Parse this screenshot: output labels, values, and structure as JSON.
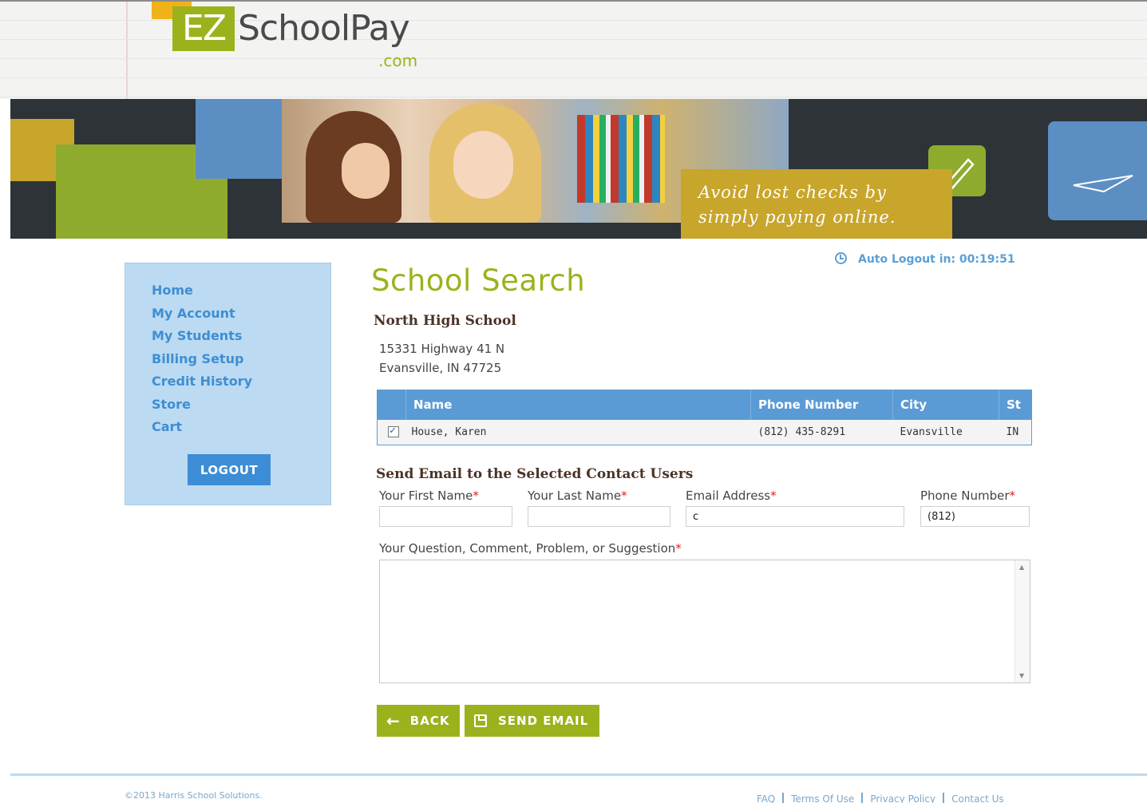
{
  "brand": {
    "logo_ez": "EZ",
    "logo_word": "SchoolPay",
    "logo_com": ".com"
  },
  "banner": {
    "tagline_line1": "Avoid lost checks by",
    "tagline_line2": "simply paying online."
  },
  "sidebar": {
    "items": [
      {
        "label": "Home"
      },
      {
        "label": "My Account"
      },
      {
        "label": "My Students"
      },
      {
        "label": "Billing Setup"
      },
      {
        "label": "Credit History"
      },
      {
        "label": "Store"
      },
      {
        "label": "Cart"
      }
    ],
    "logout_label": "LOGOUT"
  },
  "session": {
    "auto_logout": "Auto Logout in: 00:19:51"
  },
  "main": {
    "title": "School Search",
    "school_name": "North High School",
    "address_line1": "15331 Highway 41 N",
    "address_line2": "Evansville, IN  47725"
  },
  "contacts": {
    "columns": [
      "Name",
      "Phone Number",
      "City",
      "St"
    ],
    "rows": [
      {
        "checked": true,
        "name": "House, Karen",
        "phone": "(812) 435-8291",
        "city": "Evansville",
        "state": "IN"
      }
    ]
  },
  "form": {
    "section_title": "Send Email to the Selected Contact Users",
    "first_name_label": "Your First Name",
    "last_name_label": "Your Last Name",
    "email_label": "Email Address",
    "phone_label": "Phone Number",
    "required_mark": "*",
    "first_name_value": "",
    "last_name_value": "",
    "email_value": "c",
    "phone_value": "(812) ",
    "question_label": "Your Question, Comment, Problem, or Suggestion",
    "question_value": ""
  },
  "actions": {
    "back_label": "BACK",
    "send_label": "SEND EMAIL"
  },
  "footer": {
    "copyright": "©2013 Harris School Solutions.",
    "links": [
      "FAQ",
      "Terms Of Use",
      "Privacy Policy",
      "Contact Us"
    ]
  },
  "colors": {
    "brand_green": "#9cb21c",
    "nav_blue": "#3d8ed3",
    "table_header_blue": "#5b9bd5",
    "sidebar_bg": "#bcdaf1",
    "banner_gold": "#c8a52b"
  }
}
